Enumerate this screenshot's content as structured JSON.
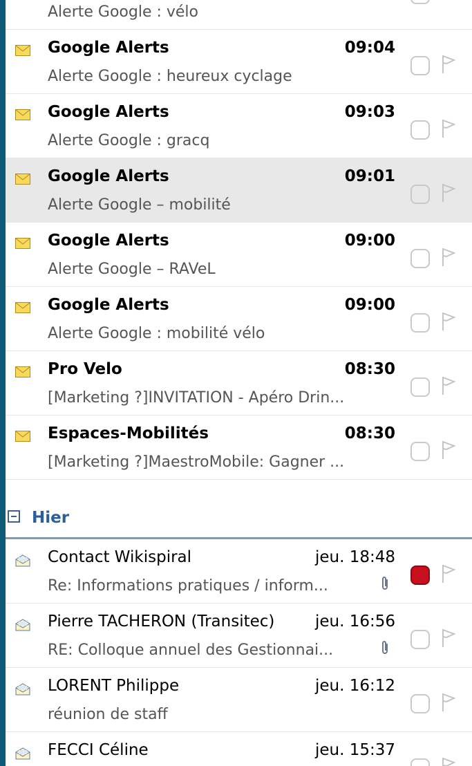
{
  "group_today": {
    "messages": [
      {
        "sender": "",
        "time": "",
        "subject": "Alerte Google : vélo",
        "partial": true
      },
      {
        "sender": "Google Alerts",
        "time": "09:04",
        "subject": "Alerte Google : heureux cyclage"
      },
      {
        "sender": "Google Alerts",
        "time": "09:03",
        "subject": "Alerte Google : gracq"
      },
      {
        "sender": "Google Alerts",
        "time": "09:01",
        "subject": "Alerte Google – mobilité",
        "selected": true
      },
      {
        "sender": "Google Alerts",
        "time": "09:00",
        "subject": "Alerte Google – RAVeL"
      },
      {
        "sender": "Google Alerts",
        "time": "09:00",
        "subject": "Alerte Google : mobilité vélo"
      },
      {
        "sender": "Pro Velo",
        "time": "08:30",
        "subject": "[Marketing ?]INVITATION - Apéro Drin..."
      },
      {
        "sender": "Espaces-Mobilités",
        "time": "08:30",
        "subject": "[Marketing ?]MaestroMobile: Gagner ..."
      }
    ]
  },
  "group_yesterday": {
    "label": "Hier",
    "messages": [
      {
        "sender": "Contact Wikispiral",
        "time": "jeu. 18:48",
        "subject": "Re: Informations pratiques / inform...",
        "attachment": true,
        "category_color": "#c8101e"
      },
      {
        "sender": "Pierre TACHERON (Transitec)",
        "time": "jeu. 16:56",
        "subject": "RE: Colloque annuel des Gestionnai...",
        "attachment": true
      },
      {
        "sender": "LORENT Philippe",
        "time": "jeu. 16:12",
        "subject": "réunion de staff"
      },
      {
        "sender": "FECCI Céline",
        "time": "jeu. 15:37",
        "subject": ""
      }
    ]
  },
  "icons": {
    "unread": "envelope-closed-icon",
    "read": "envelope-open-icon",
    "attachment": "paperclip-icon",
    "flag": "flag-icon",
    "category": "category-box-icon",
    "collapse": "collapse-minus-icon"
  },
  "colors": {
    "frame": "#0e5b78",
    "selected_row": "#e8e8e8",
    "group_label": "#2a5e9c",
    "red_category": "#c8101e"
  }
}
